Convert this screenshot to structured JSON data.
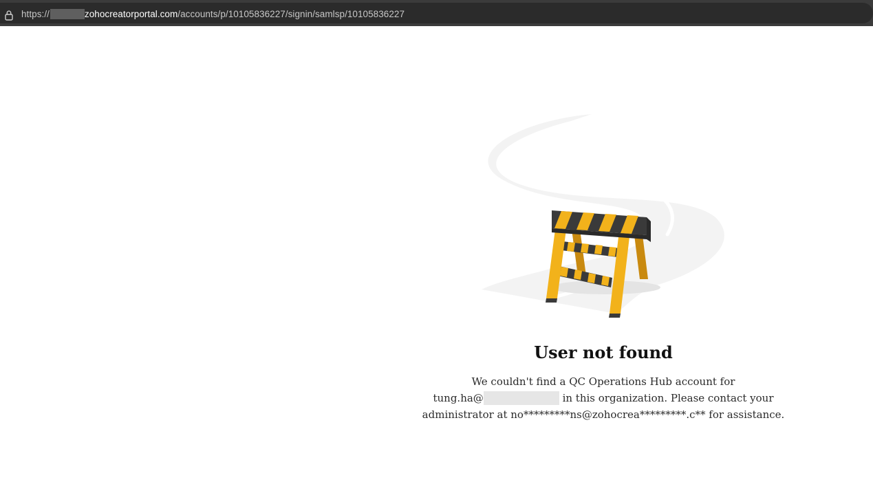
{
  "browser": {
    "url_prefix": "https://",
    "url_host": "zohocreatorportal.com",
    "url_path": "/accounts/p/10105836227/signin/samlsp/10105836227"
  },
  "icons": {
    "lock": "lock-icon",
    "illustration": "road-barrier-icon"
  },
  "colors": {
    "barrier_yellow": "#f2b21b",
    "barrier_dark": "#3a3a3a",
    "road": "#f2f2f2"
  },
  "error": {
    "title": "User not found",
    "line1": "We couldn't find a QC Operations Hub account for",
    "line2_prefix": "tung.ha@",
    "line2_suffix": "in this organization. Please contact your",
    "line3": "administrator at no*********ns@zohocrea*********.c** for assistance."
  }
}
